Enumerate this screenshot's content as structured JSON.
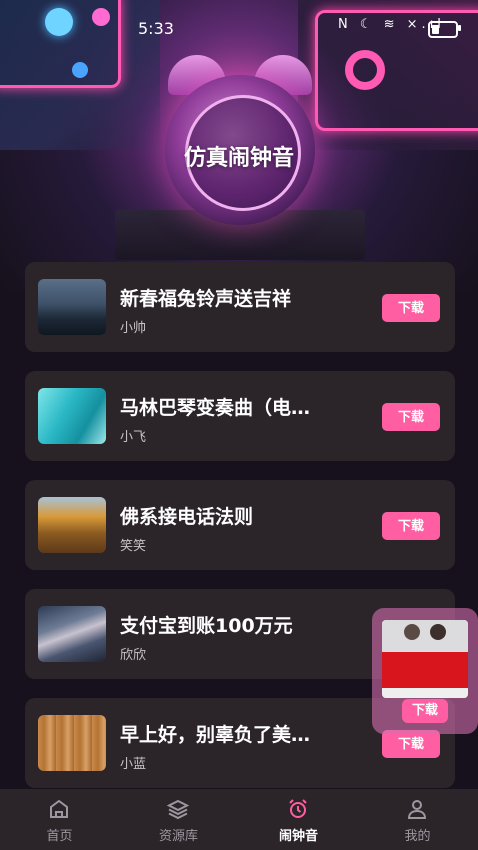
{
  "status_bar": {
    "time": "5:33",
    "icons": "N ☾ ≋ ×.ıl"
  },
  "page": {
    "title": "仿真闹钟音"
  },
  "ringtones": [
    {
      "title": "新春福兔铃声送吉祥",
      "author": "小帅",
      "action": "下载"
    },
    {
      "title": "马林巴琴变奏曲（电…",
      "author": "小飞",
      "action": "下载"
    },
    {
      "title": "佛系接电话法则",
      "author": "笑笑",
      "action": "下载"
    },
    {
      "title": "支付宝到账100万元",
      "author": "欣欣",
      "action": "下载"
    },
    {
      "title": "早上好，别辜负了美…",
      "author": "小蓝",
      "action": "下载"
    }
  ],
  "float_player": {
    "action": "下载"
  },
  "tabbar": {
    "items": [
      {
        "label": "首页",
        "icon": "home-icon"
      },
      {
        "label": "资源库",
        "icon": "layers-icon"
      },
      {
        "label": "闹钟音",
        "icon": "alarm-clock-icon",
        "active": true
      },
      {
        "label": "我的",
        "icon": "user-icon"
      }
    ]
  },
  "colors": {
    "accent": "#ff5fa2",
    "card": "#2b2429",
    "background": "#16111c"
  }
}
